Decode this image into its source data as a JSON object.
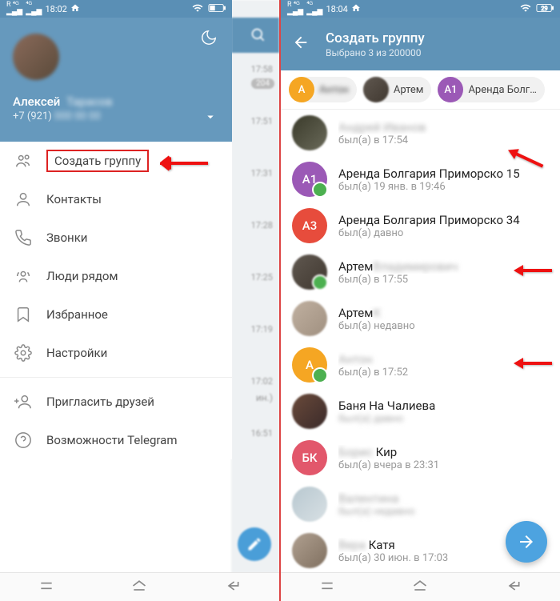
{
  "left": {
    "status": {
      "time": "18:02",
      "net": "4G"
    },
    "profile": {
      "name": "Алексей",
      "name_blur": "Тарасов",
      "phone": "+7 (921)",
      "phone_blur": "000 00 00"
    },
    "menu": [
      {
        "id": "create-group",
        "label": "Создать группу",
        "highlighted": true
      },
      {
        "id": "contacts",
        "label": "Контакты"
      },
      {
        "id": "calls",
        "label": "Звонки"
      },
      {
        "id": "nearby",
        "label": "Люди рядом"
      },
      {
        "id": "saved",
        "label": "Избранное"
      },
      {
        "id": "settings",
        "label": "Настройки"
      },
      {
        "id": "invite",
        "label": "Пригласить друзей"
      },
      {
        "id": "faq",
        "label": "Возможности Telegram"
      }
    ],
    "bg_times": [
      "17:58",
      "17:51",
      "17:31",
      "17:28",
      "17:25",
      "17:19",
      "17:02",
      "16:51"
    ],
    "bg_badge": "204",
    "bg_snippet": "ин.)"
  },
  "right": {
    "status": {
      "time": "18:04",
      "net": "4G"
    },
    "header": {
      "title": "Создать группу",
      "subtitle": "Выбрано 3 из 200000"
    },
    "chips": [
      {
        "avatar": "А",
        "color": "c-orange",
        "label": "",
        "blur": true
      },
      {
        "avatar": "",
        "color": "c-img2",
        "label": "Артем"
      },
      {
        "avatar": "А1",
        "color": "c-purple",
        "label": "Аренда Болг…"
      }
    ],
    "contacts": [
      {
        "avatar": "",
        "color": "c-img1",
        "name": "",
        "name_blur": "Андрей Иванов",
        "status": "был(а) в 17:54",
        "selected": false
      },
      {
        "avatar": "А1",
        "color": "c-purple",
        "name": "Аренда Болгария Приморско 15",
        "status": "был(а) 19 янв. в 19:46",
        "selected": true,
        "arrow": true
      },
      {
        "avatar": "А3",
        "color": "c-red",
        "name": "Аренда Болгария Приморско 34",
        "status": "был(а) давно",
        "selected": false
      },
      {
        "avatar": "",
        "color": "c-img2",
        "name": "Артем",
        "name_blur": "Владимирович",
        "status": "был(а) в 17:55",
        "selected": true,
        "dot": true,
        "arrow": true
      },
      {
        "avatar": "",
        "color": "c-img3",
        "name": "Артем",
        "name_blur": "К",
        "status": "был(а) недавно",
        "selected": false
      },
      {
        "avatar": "А",
        "color": "c-orange",
        "name": "",
        "name_blur": "Антон",
        "status": "был(а) в 17:52",
        "selected": true,
        "arrow": true
      },
      {
        "avatar": "",
        "color": "c-img4",
        "name": "Баня На Чалиева",
        "status": "",
        "status_blur": "был(а) давно",
        "selected": false
      },
      {
        "avatar": "БК",
        "color": "c-redp",
        "name": "",
        "name_blur": "Борис",
        "name2": "Кир",
        "status": "был(а) вчера в 23:31",
        "selected": false
      },
      {
        "avatar": "",
        "color": "c-img5",
        "name": "",
        "name_blur": "Валентина",
        "status": "",
        "status_blur": "был(а) недавно",
        "selected": false
      },
      {
        "avatar": "",
        "color": "c-img6",
        "name": "",
        "name_blur": "Вера",
        "name2": "Катя",
        "status": "был(а) 30 июн. в 17:03",
        "selected": false
      }
    ]
  }
}
